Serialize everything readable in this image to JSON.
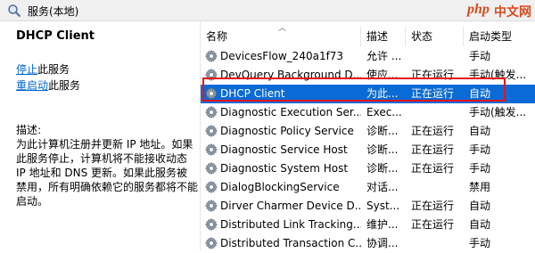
{
  "window": {
    "title": "服务(本地)"
  },
  "watermark": {
    "site": "php",
    "cn": "中文网"
  },
  "detail": {
    "service_name": "DHCP Client",
    "stop_link": "停止",
    "stop_suffix": "此服务",
    "restart_link": "重启动",
    "restart_suffix": "此服务",
    "description_label": "描述:",
    "description": "为此计算机注册并更新 IP 地址。如果此服务停止，计算机将不能接收动态 IP 地址和 DNS 更新。如果此服务被禁用，所有明确依赖它的服务都将不能启动。"
  },
  "columns": {
    "name": "名称",
    "desc": "描述",
    "status": "状态",
    "startup": "启动类型"
  },
  "services": [
    {
      "name": "DevicesFlow_240a1f73",
      "desc": "允许 ...",
      "status": "",
      "startup": "手动"
    },
    {
      "name": "DevQuery Background D...",
      "desc": "使应...",
      "status": "正在运行",
      "startup": "手动(触发..."
    },
    {
      "name": "DHCP Client",
      "desc": "为此...",
      "status": "正在运行",
      "startup": "自动"
    },
    {
      "name": "Diagnostic Execution Ser...",
      "desc": "Exec...",
      "status": "",
      "startup": "手动(触发..."
    },
    {
      "name": "Diagnostic Policy Service",
      "desc": "诊断...",
      "status": "正在运行",
      "startup": "自动"
    },
    {
      "name": "Diagnostic Service Host",
      "desc": "诊断...",
      "status": "正在运行",
      "startup": "手动"
    },
    {
      "name": "Diagnostic System Host",
      "desc": "诊断...",
      "status": "正在运行",
      "startup": "手动"
    },
    {
      "name": "DialogBlockingService",
      "desc": "对话...",
      "status": "",
      "startup": "禁用"
    },
    {
      "name": "Dirver Charmer Device D...",
      "desc": "Syst...",
      "status": "正在运行",
      "startup": "自动"
    },
    {
      "name": "Distributed Link Tracking...",
      "desc": "维护...",
      "status": "正在运行",
      "startup": "自动"
    },
    {
      "name": "Distributed Transaction C...",
      "desc": "协调...",
      "status": "",
      "startup": "手动"
    }
  ],
  "selected_index": 2,
  "colors": {
    "selection": "#0a6bd6",
    "highlight_border": "#e8141b",
    "link": "#0066cc"
  }
}
